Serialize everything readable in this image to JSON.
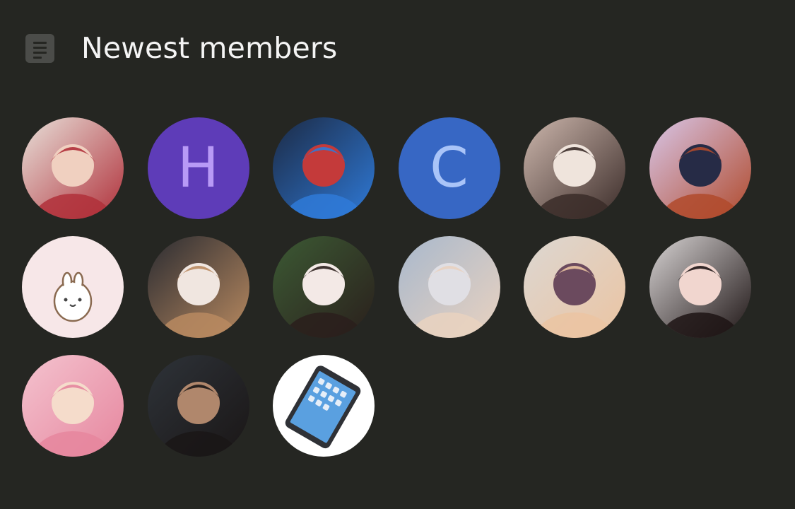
{
  "header": {
    "title": "Newest members",
    "icon": "document-icon"
  },
  "members": [
    {
      "type": "photo",
      "name": "member-1",
      "colors": [
        "#e8e1da",
        "#b0303a",
        "#f0d0c0"
      ]
    },
    {
      "type": "letter",
      "letter": "H",
      "bg": "#5e3cb8",
      "fg": "#b89af6"
    },
    {
      "type": "photo",
      "name": "member-3",
      "colors": [
        "#1c2a44",
        "#2f7ad8",
        "#c43a3a"
      ]
    },
    {
      "type": "letter",
      "letter": "C",
      "bg": "#3767c4",
      "fg": "#a9c4f8"
    },
    {
      "type": "photo",
      "name": "member-5",
      "colors": [
        "#cdb7ad",
        "#3a2b28",
        "#efe4dc"
      ]
    },
    {
      "type": "photo",
      "name": "member-6",
      "colors": [
        "#d8c6e8",
        "#b04a2c",
        "#262b46"
      ]
    },
    {
      "type": "photo",
      "name": "member-7",
      "colors": [
        "#f7e7e8",
        "#ffffff",
        "#8a6a50"
      ]
    },
    {
      "type": "photo",
      "name": "member-8",
      "colors": [
        "#2a2b31",
        "#b98a60",
        "#f0e6e0"
      ]
    },
    {
      "type": "photo",
      "name": "member-9",
      "colors": [
        "#3c5a34",
        "#2a1f1c",
        "#f3e9e6"
      ]
    },
    {
      "type": "photo",
      "name": "member-10",
      "colors": [
        "#a8b8cc",
        "#e9d2c0",
        "#e0dfe4"
      ]
    },
    {
      "type": "photo",
      "name": "member-11",
      "colors": [
        "#dcd7d2",
        "#ebc4a2",
        "#6b4a5e"
      ]
    },
    {
      "type": "photo",
      "name": "member-12",
      "colors": [
        "#d8d4d4",
        "#1d1414",
        "#f1d6cf"
      ]
    },
    {
      "type": "photo",
      "name": "member-13",
      "colors": [
        "#f4c3cf",
        "#e6869e",
        "#f5dccb"
      ]
    },
    {
      "type": "photo",
      "name": "member-14",
      "colors": [
        "#2e3339",
        "#1a1616",
        "#b0876c"
      ]
    },
    {
      "type": "photo",
      "name": "member-15",
      "colors": [
        "#ffffff",
        "#2f3136",
        "#5aa0e0"
      ]
    }
  ]
}
